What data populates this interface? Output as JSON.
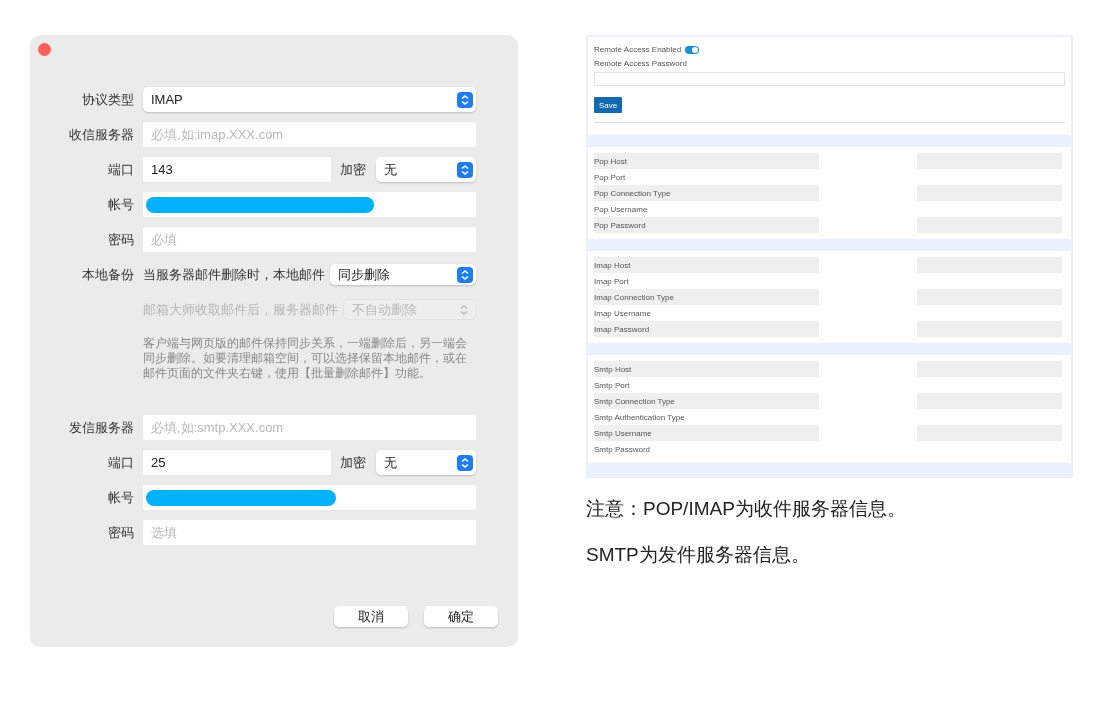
{
  "dialog": {
    "incoming": [
      {
        "kind": "select",
        "label": "协议类型",
        "value": "IMAP"
      },
      {
        "kind": "input",
        "label": "收信服务器",
        "placeholder": "必填,如:imap.XXX.com"
      },
      {
        "kind": "port",
        "label": "端口",
        "value": "143",
        "enc_label": "加密",
        "enc_value": "无"
      },
      {
        "kind": "redacted",
        "label": "帐号"
      },
      {
        "kind": "input",
        "label": "密码",
        "placeholder": "必填"
      },
      {
        "kind": "option",
        "label": "本地备份",
        "text": "当服务器邮件删除时，本地邮件",
        "value": "同步删除",
        "disabled": false
      },
      {
        "kind": "option",
        "text": "邮箱大师收取邮件后，服务器邮件",
        "value": "不自动删除",
        "disabled": true
      },
      {
        "kind": "note",
        "text": "客户端与网页版的邮件保持同步关系，一端删除后，另一端会同步删除。如要清理邮箱空间，可以选择保留本地邮件，或在邮件页面的文件夹右键，使用【批量删除邮件】功能。"
      }
    ],
    "outgoing": [
      {
        "kind": "input",
        "label": "发信服务器",
        "placeholder": "必填,如:smtp.XXX.com"
      },
      {
        "kind": "port",
        "label": "端口",
        "value": "25",
        "enc_label": "加密",
        "enc_value": "无"
      },
      {
        "kind": "redacted",
        "label": "帐号"
      },
      {
        "kind": "input",
        "label": "密码",
        "placeholder": "选填"
      }
    ],
    "buttons": [
      "取消",
      "确定"
    ]
  },
  "web": {
    "remote_access": {
      "label": "Remote Access Enabled",
      "on": true
    },
    "password_label": "Remote Access Password",
    "save_button": "Save",
    "sections": [
      [
        "Pop Host",
        "Pop Port",
        "Pop Connection Type",
        "Pop Username",
        "Pop Password"
      ],
      [
        "Imap Host",
        "Imap Port",
        "Imap Connection Type",
        "Imap Username",
        "Imap Password"
      ],
      [
        "Smtp Host",
        "Smtp Port",
        "Smtp Connection Type",
        "Smtp Authentication Type",
        "Smtp Username",
        "Smtp Password"
      ]
    ]
  },
  "notes": [
    "注意：POP/IMAP为收件服务器信息。",
    "SMTP为发件服务器信息。"
  ]
}
